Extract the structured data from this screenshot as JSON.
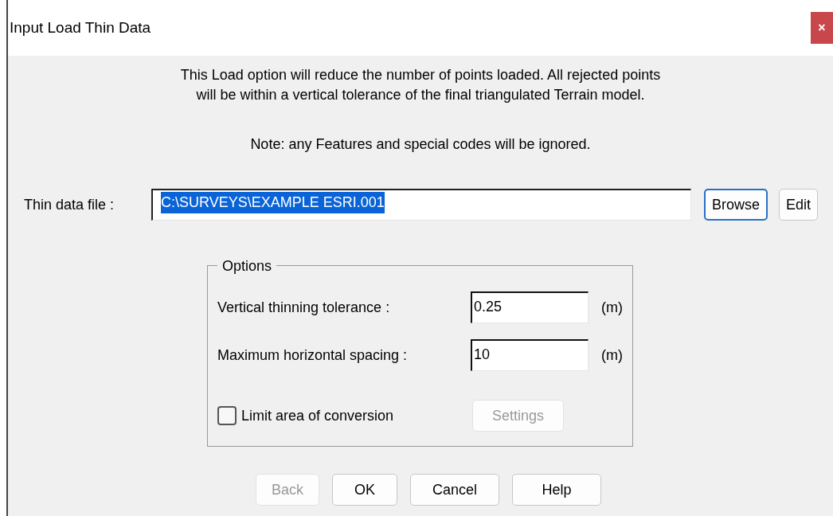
{
  "window": {
    "title": "Input Load Thin Data",
    "close": "×"
  },
  "description": [
    "This Load option will reduce the number of points loaded. All rejected points",
    "will be within a vertical tolerance of the final triangulated Terrain model."
  ],
  "note": "Note: any Features and special codes will be ignored.",
  "file": {
    "label": "Thin data file :",
    "value": "C:\\SURVEYS\\EXAMPLE ESRI.001",
    "highlighted": true,
    "buttons": [
      {
        "label": "Browse",
        "focused": true
      },
      {
        "label": "Edit",
        "focused": false
      }
    ]
  },
  "options": {
    "title": "Options",
    "fields": [
      {
        "label": "Vertical thinning tolerance :",
        "value": "0.25",
        "unit": "(m)"
      },
      {
        "label": "Maximum horizontal spacing :",
        "value": "10",
        "unit": "(m)"
      }
    ],
    "checkbox": {
      "label": "Limit area of conversion",
      "checked": false
    },
    "settings_button": {
      "label": "Settings",
      "disabled": true
    }
  },
  "buttons": [
    {
      "label": "Back",
      "disabled": true
    },
    {
      "label": "OK",
      "disabled": false
    },
    {
      "label": "Cancel",
      "disabled": false
    },
    {
      "label": "Help",
      "disabled": false
    }
  ]
}
